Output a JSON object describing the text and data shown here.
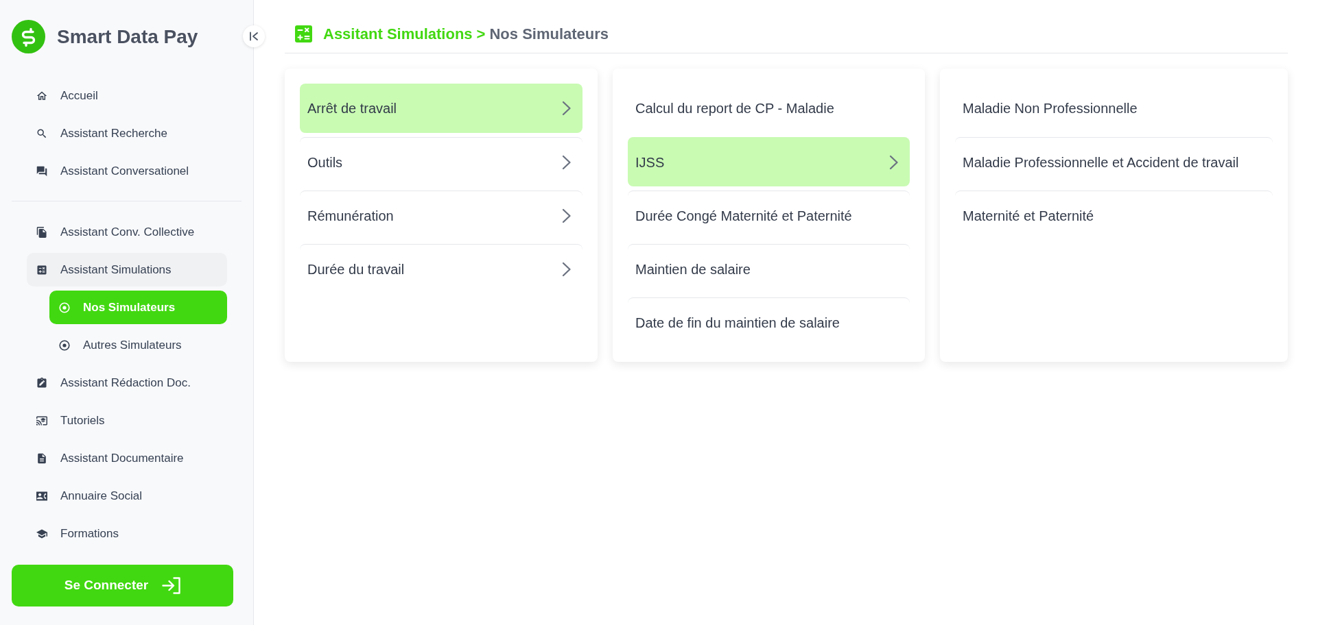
{
  "sidebar": {
    "brand": "Smart Data Pay",
    "sections": [
      {
        "items": [
          {
            "label": "Accueil",
            "selected": false
          },
          {
            "label": "Assistant Recherche",
            "selected": false
          },
          {
            "label": "Assistant Conversationel",
            "selected": false
          }
        ]
      },
      {
        "items": [
          {
            "label": "Assistant Conv. Collective",
            "selected": false
          },
          {
            "label": "Assistant Simulations",
            "selected": false,
            "children": [
              {
                "label": "Nos Simulateurs",
                "selected": true
              },
              {
                "label": "Autres Simulateurs",
                "selected": false
              }
            ]
          },
          {
            "label": "Assistant Rédaction Doc.",
            "selected": false
          },
          {
            "label": "Tutoriels",
            "selected": false
          },
          {
            "label": "Assistant Documentaire",
            "selected": false
          },
          {
            "label": "Annuaire Social",
            "selected": false
          },
          {
            "label": "Formations",
            "selected": false
          }
        ]
      }
    ],
    "login_button": "Se Connecter"
  },
  "breadcrumb": {
    "parent": "Assitant Simulations",
    "separator": ">",
    "current": "Nos Simulateurs"
  },
  "columns": [
    {
      "items": [
        {
          "label": "Arrêt de travail",
          "kind": "submenu",
          "selected": true
        },
        {
          "label": "Outils",
          "kind": "submenu",
          "selected": false
        },
        {
          "label": "Rémunération",
          "kind": "submenu",
          "selected": false
        },
        {
          "label": "Durée du travail",
          "kind": "submenu",
          "selected": false
        }
      ]
    },
    {
      "items": [
        {
          "label": "Calcul du report de CP - Maladie",
          "kind": "link",
          "selected": false
        },
        {
          "label": "IJSS",
          "kind": "submenu",
          "selected": true
        },
        {
          "label": "Durée Congé Maternité et Paternité",
          "kind": "link",
          "selected": false
        },
        {
          "label": "Maintien de salaire",
          "kind": "link",
          "selected": false
        },
        {
          "label": "Date de fin du maintien de salaire",
          "kind": "link",
          "selected": false
        }
      ]
    },
    {
      "items": [
        {
          "label": "Maladie Non Professionnelle",
          "kind": "link",
          "selected": false
        },
        {
          "label": "Maladie Professionnelle et Accident de travail",
          "kind": "link",
          "selected": false
        },
        {
          "label": "Maternité et Paternité",
          "kind": "link",
          "selected": false
        }
      ]
    }
  ]
}
